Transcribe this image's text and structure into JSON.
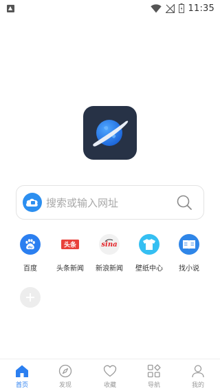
{
  "status_bar": {
    "time": "11:35",
    "icons": [
      "notification-icon",
      "wifi-icon",
      "no-signal-icon",
      "battery-icon"
    ]
  },
  "app_logo": {
    "icon": "planet-logo-icon"
  },
  "search": {
    "placeholder": "搜索或输入网址",
    "engine_icon": "search-engine-icon",
    "search_icon": "search-icon"
  },
  "quick_links": [
    {
      "label": "百度",
      "icon": "baidu-icon"
    },
    {
      "label": "头条新闻",
      "icon": "toutiao-icon",
      "icon_text": "头条"
    },
    {
      "label": "新浪新闻",
      "icon": "sina-icon",
      "icon_text": "sina"
    },
    {
      "label": "壁纸中心",
      "icon": "tshirt-icon"
    },
    {
      "label": "找小说",
      "icon": "book-icon"
    }
  ],
  "add_button": {
    "icon": "plus-icon"
  },
  "bottom_nav": {
    "active": "首页",
    "items": [
      {
        "label": "首页",
        "icon": "home-icon"
      },
      {
        "label": "发现",
        "icon": "compass-icon"
      },
      {
        "label": "收藏",
        "icon": "heart-icon"
      },
      {
        "label": "导航",
        "icon": "grid-icon"
      },
      {
        "label": "我的",
        "icon": "user-icon"
      }
    ]
  },
  "colors": {
    "accent": "#2b7ff0",
    "logo_bg": "#273246",
    "inactive": "#9a9a9a"
  }
}
